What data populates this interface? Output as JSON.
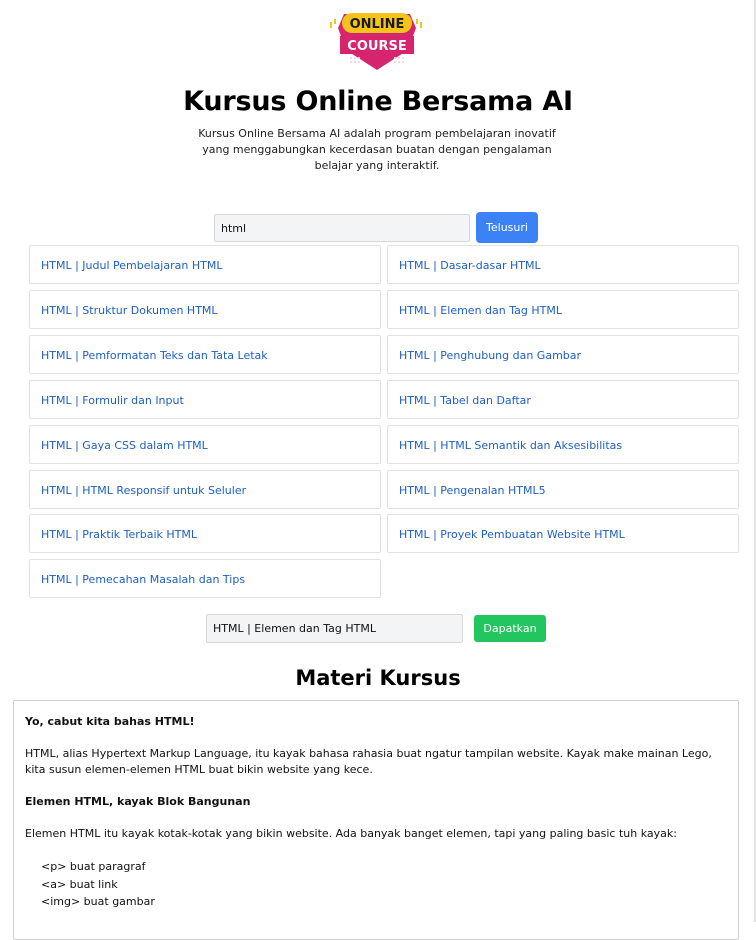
{
  "logo": {
    "line1": "ONLINE",
    "line2": "COURSE",
    "colors": {
      "badge": "#d6246e",
      "banner": "#f6c21c",
      "text": "#ffffff"
    }
  },
  "header": {
    "title": "Kursus Online Bersama AI",
    "subtitle": "Kursus Online Bersama AI adalah program pembelajaran inovatif yang menggabungkan kecerdasan buatan dengan pengalaman belajar yang interaktif."
  },
  "search": {
    "value": "html",
    "button_label": "Telusuri"
  },
  "results": [
    "HTML | Judul Pembelajaran HTML",
    "HTML | Dasar-dasar HTML",
    "HTML | Struktur Dokumen HTML",
    "HTML | Elemen dan Tag HTML",
    "HTML | Pemformatan Teks dan Tata Letak",
    "HTML | Penghubung dan Gambar",
    "HTML | Formulir dan Input",
    "HTML | Tabel dan Daftar",
    "HTML | Gaya CSS dalam HTML",
    "HTML | HTML Semantik dan Aksesibilitas",
    "HTML | HTML Responsif untuk Seluler",
    "HTML | Pengenalan HTML5",
    "HTML | Praktik Terbaik HTML",
    "HTML | Proyek Pembuatan Website HTML",
    "HTML | Pemecahan Masalah dan Tips"
  ],
  "selection": {
    "value": "HTML | Elemen dan Tag HTML",
    "button_label": "Dapatkan"
  },
  "materi": {
    "title": "Materi Kursus",
    "intro_heading": "Yo, cabut kita bahas HTML!",
    "intro_text": "HTML, alias Hypertext Markup Language, itu kayak bahasa rahasia buat ngatur tampilan website. Kayak make mainan Lego, kita susun elemen-elemen HTML buat bikin website yang kece.",
    "section_heading": "Elemen HTML, kayak Blok Bangunan",
    "section_text": "Elemen HTML itu kayak kotak-kotak yang bikin website. Ada banyak banget elemen, tapi yang paling basic tuh kayak:",
    "list": [
      "<p> buat paragraf",
      "<a> buat link",
      "<img> buat gambar"
    ]
  },
  "colors": {
    "primary_button": "#3b82f6",
    "success_button": "#22c55e",
    "link": "#1d5fc2"
  }
}
